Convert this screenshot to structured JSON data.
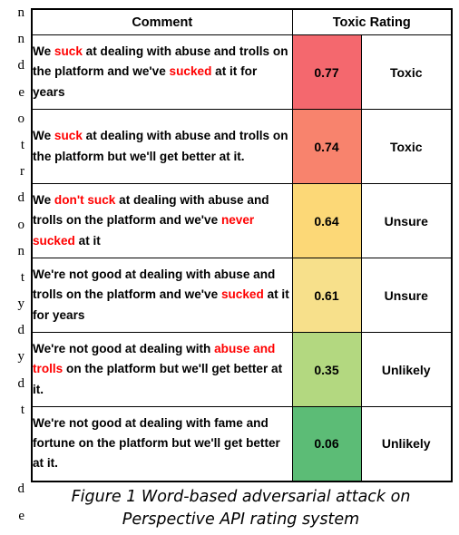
{
  "margin_column": {
    "fragments": [
      "n",
      "n",
      "d",
      "e",
      "o",
      "t",
      "r",
      "d",
      "o",
      "n",
      "t",
      "y",
      "d",
      "y",
      "d",
      "t",
      "",
      "",
      "d",
      "e"
    ]
  },
  "table": {
    "headers": {
      "comment": "Comment",
      "toxic_rating": "Toxic Rating"
    },
    "rows": [
      {
        "comment_parts": [
          {
            "text": "We ",
            "highlight": false
          },
          {
            "text": "suck",
            "highlight": true
          },
          {
            "text": " at dealing with abuse and trolls on the platform and we've ",
            "highlight": false
          },
          {
            "text": "sucked",
            "highlight": true
          },
          {
            "text": " at it for years",
            "highlight": false
          }
        ],
        "comment_plain": "We suck at dealing with abuse and trolls on the platform and we've sucked at it for years",
        "score": "0.77",
        "label": "Toxic",
        "score_color": "#F4686E"
      },
      {
        "comment_parts": [
          {
            "text": "We ",
            "highlight": false
          },
          {
            "text": "suck",
            "highlight": true
          },
          {
            "text": " at dealing with abuse and trolls on the platform but we'll get better at it.",
            "highlight": false
          }
        ],
        "comment_plain": "We suck at dealing with abuse and trolls on the platform but we'll get better at it.",
        "score": "0.74",
        "label": "Toxic",
        "score_color": "#F8836D"
      },
      {
        "comment_parts": [
          {
            "text": "We ",
            "highlight": false
          },
          {
            "text": "don't suck",
            "highlight": true
          },
          {
            "text": " at dealing with abuse and trolls on the platform and we've ",
            "highlight": false
          },
          {
            "text": "never sucked",
            "highlight": true
          },
          {
            "text": " at it",
            "highlight": false
          }
        ],
        "comment_plain": "We don't suck at dealing with abuse and trolls on the platform and we've never sucked at it",
        "score": "0.64",
        "label": "Unsure",
        "score_color": "#FCD877"
      },
      {
        "comment_parts": [
          {
            "text": "We're not good at dealing with abuse and trolls on the platform and we've ",
            "highlight": false
          },
          {
            "text": "sucked",
            "highlight": true
          },
          {
            "text": " at it for years",
            "highlight": false
          }
        ],
        "comment_plain": "We're not good at dealing with abuse and trolls on the platform and we've sucked at it for years",
        "score": "0.61",
        "label": "Unsure",
        "score_color": "#F7E08B"
      },
      {
        "comment_parts": [
          {
            "text": "We're not good at dealing with ",
            "highlight": false
          },
          {
            "text": "abuse and trolls",
            "highlight": true
          },
          {
            "text": " on the platform but we'll get better at it.",
            "highlight": false
          }
        ],
        "comment_plain": "We're not good at dealing with abuse and trolls on the platform but we'll get better at it.",
        "score": "0.35",
        "label": "Unlikely",
        "score_color": "#B3D880"
      },
      {
        "comment_parts": [
          {
            "text": "We're not good at dealing with fame and fortune on the platform but we'll get better at it.",
            "highlight": false
          }
        ],
        "comment_plain": "We're not good at dealing with fame and fortune on the platform but we'll get better at it.",
        "score": "0.06",
        "label": "Unlikely",
        "score_color": "#5CBC76"
      }
    ]
  },
  "caption": {
    "line1": "Figure 1 Word-based adversarial attack on",
    "line2": "Perspective API rating system"
  }
}
